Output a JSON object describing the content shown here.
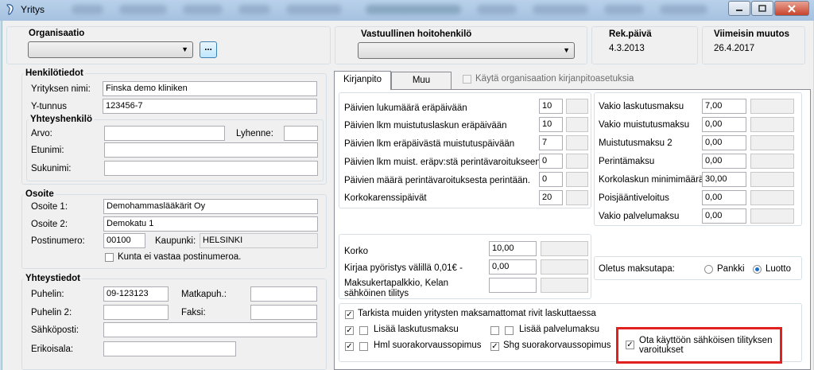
{
  "window": {
    "title": "Yritys"
  },
  "header": {
    "org_label": "Organisaatio",
    "dots_label": "...",
    "vastuu_label": "Vastuullinen hoitohenkilö",
    "rek_label": "Rek.päivä",
    "rek_value": "4.3.2013",
    "muutos_label": "Viimeisin muutos",
    "muutos_value": "26.4.2017"
  },
  "henkilo": {
    "title": "Henkilötiedot",
    "nimi_label": "Yrityksen nimi:",
    "nimi_value": "Finska demo kliniken",
    "ytunnus_label": "Y-tunnus",
    "ytunnus_value": "123456-7",
    "yhteys_title": "Yhteyshenkilö",
    "arvo_label": "Arvo:",
    "lyhenne_label": "Lyhenne:",
    "etunimi_label": "Etunimi:",
    "sukunimi_label": "Sukunimi:"
  },
  "osoite": {
    "title": "Osoite",
    "o1_label": "Osoite 1:",
    "o1_value": "Demohammaslääkärit Oy",
    "o2_label": "Osoite 2:",
    "o2_value": "Demokatu 1",
    "pn_label": "Postinumero:",
    "pn_value": "00100",
    "kaupunki_label": "Kaupunki:",
    "kaupunki_value": "HELSINKI",
    "kunta_label": "Kunta ei vastaa postinumeroa."
  },
  "yhteystiedot": {
    "title": "Yhteystiedot",
    "puhelin_label": "Puhelin:",
    "puhelin_value": "09-123123",
    "matkapuh_label": "Matkapuh.:",
    "puhelin2_label": "Puhelin 2:",
    "faksi_label": "Faksi:",
    "sahkoposti_label": "Sähköposti:",
    "erikoisala_label": "Erikoisala:"
  },
  "tabs": {
    "kirjanpito": "Kirjanpito",
    "muu": "Muu",
    "kayta_label": "Käytä organisaation kirjanpitoasetuksia"
  },
  "days": [
    {
      "label": "Päivien lukumäärä eräpäivään",
      "value": "10"
    },
    {
      "label": "Päivien lkm muistutuslaskun eräpäivään",
      "value": "10"
    },
    {
      "label": "Päivien lkm eräpäivästä muistutuspäivään",
      "value": "7"
    },
    {
      "label": "Päivien lkm muist. eräpv:stä perintävaroitukseen",
      "value": "0"
    },
    {
      "label": "Päivien määrä perintävaroituksesta perintään.",
      "value": "0"
    },
    {
      "label": "Korkokarenssipäivät",
      "value": "20"
    }
  ],
  "fees": [
    {
      "label": "Vakio laskutusmaksu",
      "value": "7,00"
    },
    {
      "label": "Vakio muistutusmaksu",
      "value": "0,00"
    },
    {
      "label": "Muistutusmaksu 2",
      "value": "0,00"
    },
    {
      "label": "Perintämaksu",
      "value": "0,00"
    },
    {
      "label": "Korkolaskun minimimäärä",
      "value": "30,00"
    },
    {
      "label": "Poisjäänti­veloitus",
      "value": "0,00"
    },
    {
      "label": "Vakio palvelumaksu",
      "value": "0,00"
    }
  ],
  "interest": {
    "korko_label": "Korko",
    "korko_value": "10,00",
    "pyoristys_label": "Kirjaa pyöristys välillä 0,01€ -",
    "pyoristys_value": "0,00",
    "maksukerta_line1": "Maksukertapalkkio, Kelan",
    "maksukerta_line2": "sähköinen tilitys"
  },
  "payment": {
    "label": "Oletus maksutapa:",
    "pankki": "Pankki",
    "luotto": "Luotto"
  },
  "checks": {
    "tarkista": "Tarkista muiden yritysten maksamattomat rivit laskuttaessa",
    "laskutusmaksu": "Lisää laskutusmaksu",
    "palvelumaksu": "Lisää palvelumaksu",
    "hml": "Hml suorakorvaussopimus",
    "shg": "Shg suorakorvaussopimus",
    "ota_line1": "Ota käyttöön sähköisen tilityksen",
    "ota_line2": "varoitukset"
  }
}
